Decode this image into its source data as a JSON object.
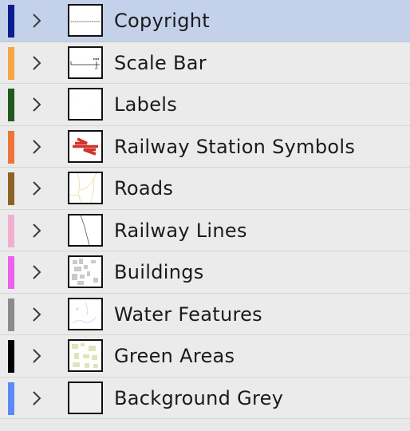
{
  "layers": [
    {
      "name": "Copyright",
      "color": "#0b1d8f",
      "selected": true,
      "thumb_icon": "copyright-thumbnail"
    },
    {
      "name": "Scale Bar",
      "color": "#f5a542",
      "selected": false,
      "thumb_icon": "scale-bar-thumbnail"
    },
    {
      "name": "Labels",
      "color": "#215a1c",
      "selected": false,
      "thumb_icon": "labels-thumbnail"
    },
    {
      "name": "Railway Station Symbols",
      "color": "#f0733a",
      "selected": false,
      "thumb_icon": "railway-station-symbol-thumbnail"
    },
    {
      "name": "Roads",
      "color": "#8a6424",
      "selected": false,
      "thumb_icon": "roads-thumbnail"
    },
    {
      "name": "Railway Lines",
      "color": "#f2aed0",
      "selected": false,
      "thumb_icon": "railway-lines-thumbnail"
    },
    {
      "name": "Buildings",
      "color": "#ea62ea",
      "selected": false,
      "thumb_icon": "buildings-thumbnail"
    },
    {
      "name": "Water Features",
      "color": "#8b8b8b",
      "selected": false,
      "thumb_icon": "water-features-thumbnail"
    },
    {
      "name": "Green Areas",
      "color": "#000000",
      "selected": false,
      "thumb_icon": "green-areas-thumbnail"
    },
    {
      "name": "Background Grey",
      "color": "#5b8af5",
      "selected": false,
      "thumb_icon": "background-grey-thumbnail"
    }
  ],
  "icons": {
    "expander": "chevron-right-icon"
  }
}
